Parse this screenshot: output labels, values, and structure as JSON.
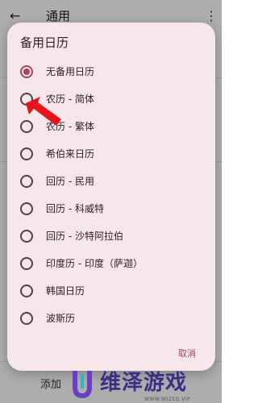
{
  "appbar": {
    "back_icon": "arrow-back-icon",
    "title": "通用",
    "more_icon": "more-vert-icon"
  },
  "background": {
    "partial_text": "添加"
  },
  "dialog": {
    "title": "备用日历",
    "options": [
      {
        "label": "无备用日历",
        "selected": true
      },
      {
        "label": "农历 - 简体",
        "selected": false
      },
      {
        "label": "农历 - 繁体",
        "selected": false
      },
      {
        "label": "希伯来日历",
        "selected": false
      },
      {
        "label": "回历 - 民用",
        "selected": false
      },
      {
        "label": "回历 - 科威特",
        "selected": false
      },
      {
        "label": "回历 - 沙特阿拉伯",
        "selected": false
      },
      {
        "label": "印度历 - 印度（萨迦）",
        "selected": false
      },
      {
        "label": "韩国日历",
        "selected": false
      },
      {
        "label": "波斯历",
        "selected": false
      }
    ],
    "cancel_label": "取消"
  },
  "watermark": {
    "name": "维泽游戏",
    "url": "WWW.WIZED.VIP"
  },
  "colors": {
    "accent": "#a2455e",
    "dialog_bg": "#f7e7ea",
    "annotation": "#e8141b",
    "watermark": "#3e2d87"
  }
}
